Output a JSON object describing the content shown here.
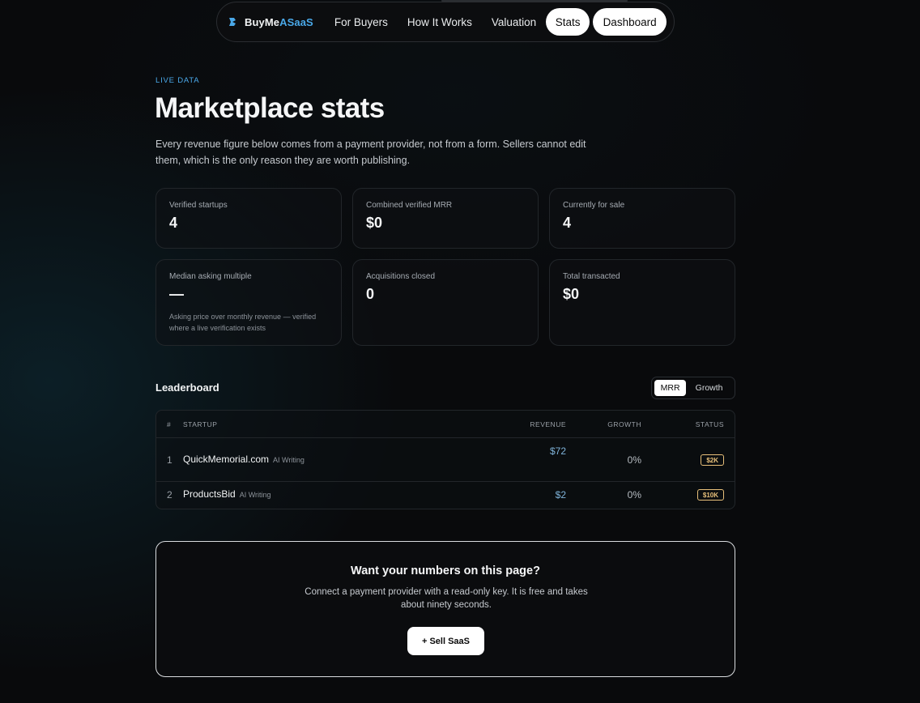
{
  "nav": {
    "brand_prefix": "BuyMe",
    "brand_accent": "ASaaS",
    "links": [
      "For Buyers",
      "How It Works",
      "Valuation"
    ],
    "stats_label": "Stats",
    "dashboard_label": "Dashboard"
  },
  "header": {
    "eyebrow": "LIVE DATA",
    "title": "Marketplace stats",
    "subtitle": "Every revenue figure below comes from a payment provider, not from a form. Sellers cannot edit them, which is the only reason they are worth publishing."
  },
  "stats": [
    {
      "label": "Verified startups",
      "value": "4"
    },
    {
      "label": "Combined verified MRR",
      "value": "$0"
    },
    {
      "label": "Currently for sale",
      "value": "4"
    },
    {
      "label": "Median asking multiple",
      "value": "—",
      "note": "Asking price over monthly revenue — verified where a live verification exists"
    },
    {
      "label": "Acquisitions closed",
      "value": "0"
    },
    {
      "label": "Total transacted",
      "value": "$0"
    }
  ],
  "leaderboard": {
    "title": "Leaderboard",
    "toggle": {
      "active": "MRR",
      "inactive": "Growth"
    },
    "columns": {
      "rank": "#",
      "startup": "STARTUP",
      "revenue": "REVENUE",
      "growth": "GROWTH",
      "status": "STATUS"
    },
    "rows": [
      {
        "rank": "1",
        "name": "QuickMemorial.com",
        "tag": "AI Writing",
        "revenue": "$72",
        "growth": "0%",
        "status": "$2K"
      },
      {
        "rank": "2",
        "name": "ProductsBid",
        "tag": "AI Writing",
        "revenue": "$2",
        "growth": "0%",
        "status": "$10K"
      }
    ]
  },
  "cta": {
    "title": "Want your numbers on this page?",
    "text": "Connect a payment provider with a read-only key. It is free and takes about ninety seconds.",
    "button": "+ Sell SaaS"
  },
  "colors": {
    "accent": "#4aa8e8",
    "badge": "#e8c07a",
    "revenue": "#7fb3d9"
  }
}
